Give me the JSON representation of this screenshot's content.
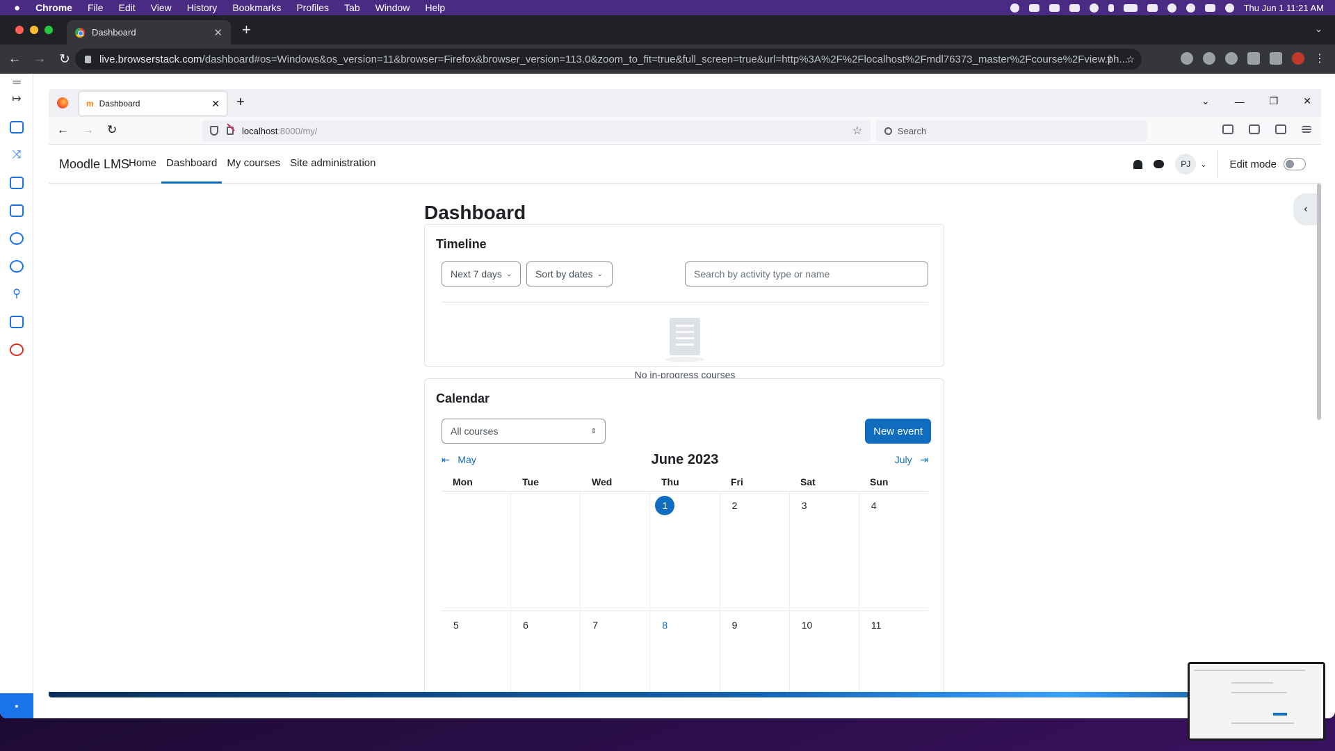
{
  "mac_menubar": {
    "apple_icon": "apple-icon",
    "app_name": "Chrome",
    "menus": [
      "File",
      "Edit",
      "View",
      "History",
      "Bookmarks",
      "Profiles",
      "Tab",
      "Window",
      "Help"
    ],
    "clock": "Thu Jun 1  11:21 AM"
  },
  "chrome": {
    "tab_title": "Dashboard",
    "url_host": "live.browserstack.com",
    "url_path": "/dashboard#os=Windows&os_version=11&browser=Firefox&browser_version=113.0&zoom_to_fit=true&full_screen=true&url=http%3A%2F%2Flocalhost%2Fmdl76373_master%2Fcourse%2Fview.ph..."
  },
  "firefox": {
    "tab_title": "Dashboard",
    "tab_icon_text": "m",
    "url_host": "localhost",
    "url_path": ":8000/my/",
    "search_placeholder": "Search"
  },
  "moodle": {
    "brand": "Moodle LMS",
    "nav": [
      {
        "label": "Home",
        "active": false
      },
      {
        "label": "Dashboard",
        "active": true
      },
      {
        "label": "My courses",
        "active": false
      },
      {
        "label": "Site administration",
        "active": false
      }
    ],
    "user_initials": "PJ",
    "edit_mode_label": "Edit mode",
    "edit_mode_on": false,
    "page_title": "Dashboard",
    "timeline": {
      "heading": "Timeline",
      "filter_label": "Next 7 days",
      "sort_label": "Sort by dates",
      "search_placeholder": "Search by activity type or name",
      "empty_text": "No in-progress courses"
    },
    "calendar": {
      "heading": "Calendar",
      "course_filter": "All courses",
      "new_event_label": "New event",
      "prev_month": "May",
      "current_month": "June 2023",
      "next_month": "July",
      "weekdays": [
        "Mon",
        "Tue",
        "Wed",
        "Thu",
        "Fri",
        "Sat",
        "Sun"
      ],
      "weeks": [
        [
          "",
          "",
          "",
          "1",
          "2",
          "3",
          "4"
        ],
        [
          "5",
          "6",
          "7",
          "8",
          "9",
          "10",
          "11"
        ]
      ],
      "today": "1",
      "highlighted_day": "8"
    }
  },
  "colors": {
    "moodle_primary": "#0f6cbf",
    "mac_menubar": "#4a2a82",
    "chrome_dark": "#202124"
  }
}
